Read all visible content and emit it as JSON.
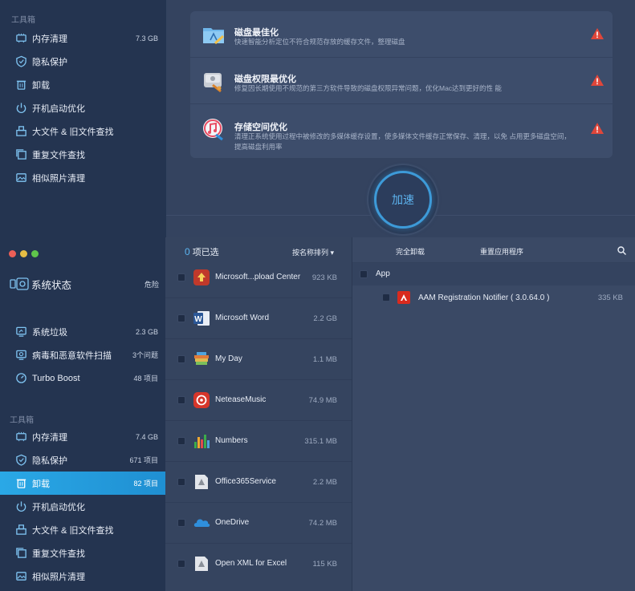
{
  "top": {
    "sidebar": {
      "section_title": "工具箱",
      "items": [
        {
          "label": "内存清理",
          "value": "7.3 GB",
          "icon": "memory-chip-icon"
        },
        {
          "label": "隐私保护",
          "value": "",
          "icon": "shield-icon"
        },
        {
          "label": "卸载",
          "value": "",
          "icon": "trash-icon"
        },
        {
          "label": "开机启动优化",
          "value": "",
          "icon": "power-icon"
        },
        {
          "label": "大文件 & 旧文件查找",
          "value": "",
          "icon": "boxes-icon"
        },
        {
          "label": "重复文件查找",
          "value": "",
          "icon": "duplicate-folder-icon"
        },
        {
          "label": "相似照片清理",
          "value": "",
          "icon": "photos-icon"
        }
      ]
    },
    "optimizations": [
      {
        "title": "磁盘最佳化",
        "desc": "快速智能分析定位不符合规范存放的缓存文件，整理磁盘",
        "icon": "disk-folder-icon"
      },
      {
        "title": "磁盘权限最优化",
        "desc": "修复因长期使用不规范的第三方软件导致的磁盘权限异常问题，优化Mac达到更好的性 能",
        "icon": "disk-utility-icon"
      },
      {
        "title": "存储空间优化",
        "desc": "清理正系统使用过程中被修改的多媒体缓存设置，使多媒体文件缓存正常保存、清理，以免 占用更多磁盘空间，提高磁盘利用率",
        "icon": "itunes-icon"
      }
    ],
    "boost_label": "加速"
  },
  "bottom": {
    "sidebar": {
      "status": {
        "title": "系统状态",
        "value": "危险"
      },
      "items": [
        {
          "label": "系统垃圾",
          "value": "2.3 GB"
        },
        {
          "label": "病毒和恶意软件扫描",
          "value": "3个问题"
        },
        {
          "label": "Turbo Boost",
          "value": "48 项目"
        }
      ],
      "section_title": "工具箱",
      "tools": [
        {
          "label": "内存清理",
          "value": "7.4 GB"
        },
        {
          "label": "隐私保护",
          "value": "671 项目"
        },
        {
          "label": "卸载",
          "value": "82 项目"
        },
        {
          "label": "开机启动优化",
          "value": ""
        },
        {
          "label": "大文件 & 旧文件查找",
          "value": ""
        },
        {
          "label": "重复文件查找",
          "value": ""
        },
        {
          "label": "相似照片清理",
          "value": ""
        }
      ]
    },
    "list": {
      "selected_count": "0",
      "selected_label": "项已选",
      "sort_label": "按名称排列 ▾",
      "apps": [
        {
          "name": "Microsoft...pload Center",
          "size": "923 KB",
          "color": "#c0392b"
        },
        {
          "name": "Microsoft Word",
          "size": "2.2 GB",
          "color": "#2b5797"
        },
        {
          "name": "My Day",
          "size": "1.1 MB",
          "color": "#e0b84f"
        },
        {
          "name": "NeteaseMusic",
          "size": "74.9 MB",
          "color": "#d6362b"
        },
        {
          "name": "Numbers",
          "size": "315.1 MB",
          "color": "#3cab4a"
        },
        {
          "name": "Office365Service",
          "size": "2.2 MB",
          "color": "#bfc4cc"
        },
        {
          "name": "OneDrive",
          "size": "74.2 MB",
          "color": "#2f8fdc"
        },
        {
          "name": "Open XML for Excel",
          "size": "115 KB",
          "color": "#bfc4cc"
        }
      ]
    },
    "detail": {
      "uninstall_label": "完全卸载",
      "reset_label": "重置应用程序",
      "group_label": "App",
      "item": {
        "name": "AAM Registration Notifier ( 3.0.64.0 )",
        "size": "335 KB"
      }
    }
  }
}
